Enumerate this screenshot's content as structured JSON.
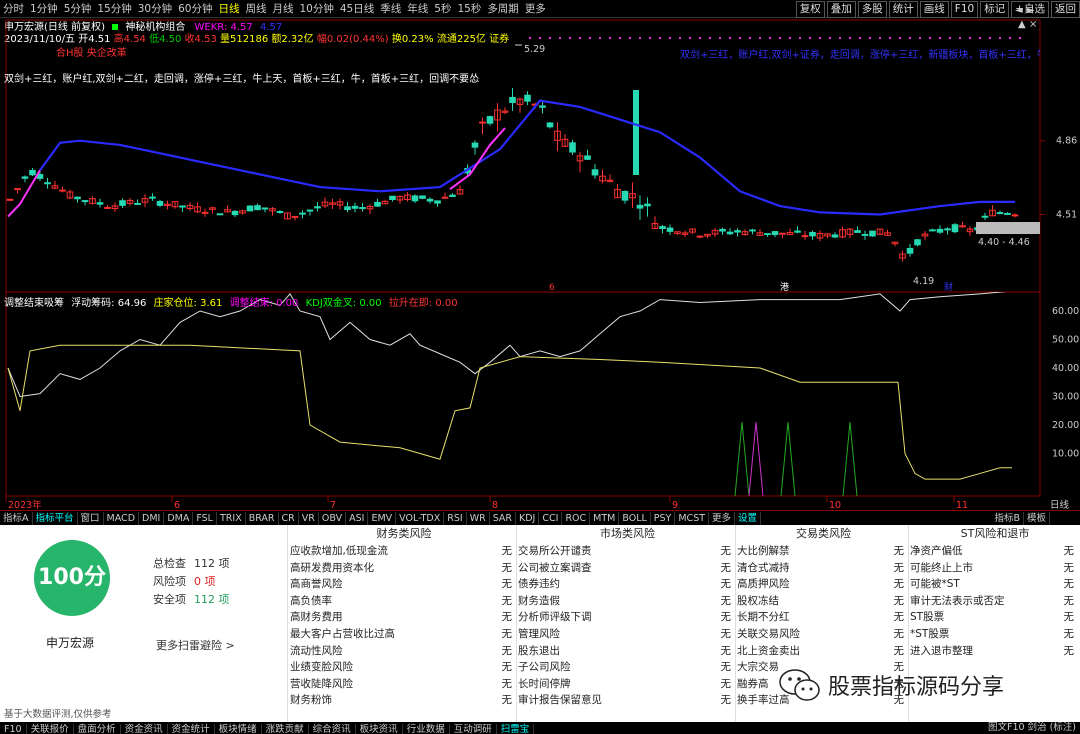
{
  "topbar": {
    "periods": [
      "分时",
      "1分钟",
      "5分钟",
      "15分钟",
      "30分钟",
      "60分钟",
      "日线",
      "周线",
      "月线",
      "10分钟",
      "45日线",
      "季线",
      "年线",
      "5秒",
      "15秒",
      "多周期",
      "更多"
    ],
    "active_period": "日线",
    "right_buttons": [
      "复权",
      "叠加",
      "多股",
      "统计",
      "画线",
      "F10",
      "标记",
      "+自选",
      "返回"
    ]
  },
  "header": {
    "title": "申万宏源(日线 前复权)",
    "indicator_name": "神秘机构组合",
    "wekr": "WEKR: 4.57",
    "wekr_val2": "4.57",
    "date": "2023/11/10/五",
    "open": "开4.51",
    "high": "高4.54",
    "low": "低4.50",
    "close": "收4.53",
    "volume": "量512186",
    "amount": "额2.32亿",
    "change": "幅0.02(0.44%)",
    "turnover": "换0.23%",
    "float": "流通225亿",
    "broker": "证券",
    "sub_tag": "合H股 央企改革"
  },
  "signals": {
    "left": "双剑+三红，账户红,双剑+二红，走回调，涨停+三红，牛上天，首板+三红，牛，首板+三红，回调不要怂",
    "right": "双剑+三红，账户红,双剑+证券，走回调，涨停+三红，新疆板块，首板+三红，牛，首板+三红"
  },
  "price_axis": {
    "labels": [
      "4.86",
      "4.51"
    ]
  },
  "price_annotations": {
    "high": "5.29",
    "low": "4.19",
    "range": "4.40 - 4.46"
  },
  "date_axis": {
    "labels": [
      "2023年",
      "6",
      "7",
      "8",
      "9",
      "10",
      "11"
    ]
  },
  "event_markers": {
    "m1": "6",
    "m2": "港",
    "m3": "财"
  },
  "indicator": {
    "name": "调整结束吸筹",
    "float_chips": "浮动筹码: 64.96",
    "dealer_pos": "庄家仓位: 3.61",
    "adjust_end": "调整结束: 0.00",
    "kdj": "KDJ双金叉: 0.00",
    "rise": "拉升在即: 0.00",
    "axis_labels": [
      "60.00",
      "50.00",
      "40.00",
      "30.00",
      "20.00",
      "10.00"
    ]
  },
  "indicator_toolbar": {
    "items": [
      "指标A",
      "指标平台",
      "窗口",
      "MACD",
      "DMI",
      "DMA",
      "FSL",
      "TRIX",
      "BRAR",
      "CR",
      "VR",
      "OBV",
      "ASI",
      "EMV",
      "VOL-TDX",
      "RSI",
      "WR",
      "SAR",
      "KDJ",
      "CCI",
      "ROC",
      "MTM",
      "BOLL",
      "PSY",
      "MCST",
      "更多",
      "设置"
    ],
    "right": [
      "指标B",
      "模板"
    ]
  },
  "panel": {
    "score": "100分",
    "stock_name": "申万宏源",
    "stats": [
      {
        "label": "总检查",
        "value": "112 项"
      },
      {
        "label": "风险项",
        "value": "0 项"
      },
      {
        "label": "安全项",
        "value": "112 项"
      }
    ],
    "more_link": "更多扫雷避险 >",
    "columns": [
      {
        "title": "财务类风险",
        "rows": [
          "应收款增加,低现金流",
          "高研发费用资本化",
          "高商誉风险",
          "高负债率",
          "高财务费用",
          "最大客户占营收比过高",
          "流动性风险",
          "业绩变脸风险",
          "营收陡降风险",
          "财务粉饰"
        ]
      },
      {
        "title": "市场类风险",
        "rows": [
          "交易所公开谴责",
          "公司被立案调查",
          "债券违约",
          "财务造假",
          "分析师评级下调",
          "管理风险",
          "股东退出",
          "子公司风险",
          "长时间停牌",
          "审计报告保留意见"
        ]
      },
      {
        "title": "交易类风险",
        "rows": [
          "大比例解禁",
          "清仓式减持",
          "高质押风险",
          "股权冻结",
          "长期不分红",
          "关联交易风险",
          "北上资金卖出",
          "大宗交易",
          "融券高",
          "换手率过高"
        ]
      },
      {
        "title": "ST风险和退市",
        "rows": [
          "净资产偏低",
          "可能终止上市",
          "可能被*ST",
          "审计无法表示或否定",
          "ST股票",
          "*ST股票",
          "进入退市整理"
        ]
      }
    ],
    "status": "无",
    "footer_note": "基于大数据评测,仅供参考",
    "watermark": "股票指标源码分享"
  },
  "bottombar": {
    "items": [
      "F10",
      "关联报价",
      "盘面分析",
      "资金资讯",
      "资金统计",
      "板块情绪",
      "涨跌贡献",
      "综合资讯",
      "板块资讯",
      "行业数据",
      "互动调研",
      "扫雷宝"
    ],
    "active": "扫雷宝",
    "right": "图文F10 剑治 (标注)"
  },
  "colors": {
    "up": "#ff3030",
    "down": "#26d9b3",
    "ma_blue": "#2a2aff",
    "ma_magenta": "#ff33ff",
    "grid_red": "#8b0000",
    "indicator_white": "#e0e0e0",
    "indicator_yellow": "#e8e06a"
  },
  "chart_data": {
    "type": "candlestick",
    "x": [
      "2023-05",
      "2023-06",
      "2023-07",
      "2023-08",
      "2023-09",
      "2023-10",
      "2023-11"
    ],
    "ylim": [
      4.19,
      5.29
    ],
    "series": [
      {
        "name": "close",
        "values": [
          4.55,
          4.62,
          4.58,
          4.72,
          4.95,
          5.1,
          4.8,
          4.6,
          4.5,
          4.45,
          4.42,
          4.4,
          4.35,
          4.3,
          4.45,
          4.5,
          4.53
        ]
      }
    ]
  }
}
